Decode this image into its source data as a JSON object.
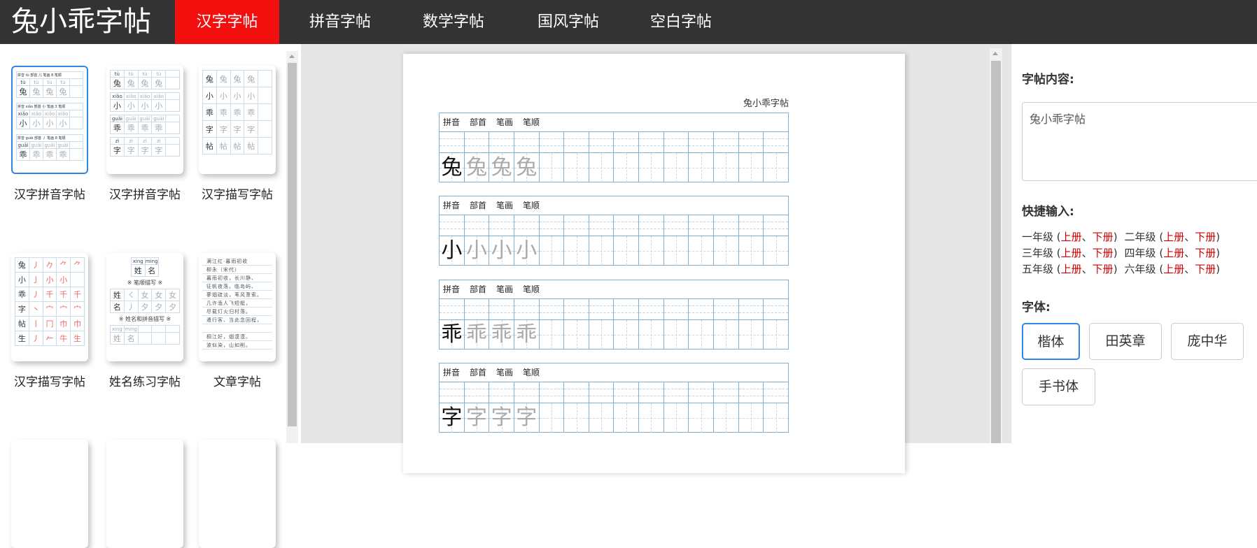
{
  "header": {
    "logo": "兔小乖字帖",
    "tabs": [
      {
        "label": "汉字字帖",
        "active": true
      },
      {
        "label": "拼音字帖"
      },
      {
        "label": "数学字帖"
      },
      {
        "label": "国风字帖"
      },
      {
        "label": "空白字帖"
      }
    ],
    "accent": "#f40f0f"
  },
  "templates": [
    {
      "label": "汉字拼音字帖",
      "selected": true,
      "blocks": [
        {
          "info": "拼音 tù   部首 儿   笔画 8   笔顺",
          "pinyin": "tù",
          "char": "兔"
        },
        {
          "info": "拼音 xiǎo   部首 小   笔画 3   笔顺",
          "pinyin": "xiǎo",
          "char": "小"
        },
        {
          "info": "拼音 guāi   部首 丿   笔画 8   笔顺",
          "pinyin": "guāi",
          "char": "乖"
        }
      ]
    },
    {
      "label": "汉字拼音字帖",
      "blocks": [
        {
          "pinyin": "tù",
          "char": "兔"
        },
        {
          "pinyin": "xiǎo",
          "char": "小"
        },
        {
          "pinyin": "guāi",
          "char": "乖"
        },
        {
          "pinyin": "zì",
          "char": "字"
        }
      ]
    },
    {
      "label": "汉字描写字帖",
      "chars": [
        "兔",
        "小",
        "乖",
        "字",
        "帖"
      ]
    },
    {
      "label": "汉字描写字帖",
      "chars": [
        "兔",
        "小",
        "乖",
        "字",
        "帖",
        "生"
      ],
      "strokes": [
        [
          "丿",
          "𠂊",
          "⺈",
          "⺈"
        ],
        [
          "亅",
          "小",
          "小",
          ""
        ],
        [
          "丿",
          "千",
          "千",
          "千"
        ],
        [
          "丶",
          "宀",
          "宀",
          "宀"
        ],
        [
          "丨",
          "冂",
          "巾",
          "巾"
        ],
        [
          "丿",
          "𠂉",
          "牛",
          "生"
        ]
      ]
    },
    {
      "label": "姓名练习字帖",
      "pinyin": [
        "xing",
        "ming"
      ],
      "name": [
        "姓",
        "名"
      ],
      "section1": "※ 笔顺描写 ※",
      "section2": "※ 姓名和拼音描写 ※",
      "strokes": [
        [
          "㇛",
          "女",
          "女",
          "女"
        ],
        [
          "丿",
          "夕",
          "夕",
          "夕"
        ]
      ]
    },
    {
      "label": "文章字帖",
      "lines": [
        "满江红·暮雨初收",
        "柳永（宋代）",
        "暮雨初收，长川静、",
        "征帆夜落。临岛屿、",
        "蓼烟疏淡，苇风萧索。",
        "几许渔人飞短艇，",
        "尽载灯火归村落。",
        "遣行客、当此念回程，",
        "",
        "桐江好，烟漠漠。",
        "波似染，山如削。"
      ]
    }
  ],
  "sheet": {
    "title": "兔小乖字帖",
    "block_header": [
      "拼音",
      "部首",
      "笔画",
      "笔顺"
    ],
    "chars": [
      "兔",
      "小",
      "乖",
      "字"
    ],
    "trace_count": 3,
    "columns": 14
  },
  "right": {
    "content_label": "字帖内容:",
    "content_value": "兔小乖字帖",
    "quick_label": "快捷输入:",
    "grades": [
      "一年级",
      "二年级",
      "三年级",
      "四年级",
      "五年级",
      "六年级"
    ],
    "upper": "上册",
    "lower": "下册",
    "font_label": "字体:",
    "fonts": [
      {
        "label": "楷体",
        "active": true
      },
      {
        "label": "田英章"
      },
      {
        "label": "庞中华"
      },
      {
        "label": "手书体"
      }
    ],
    "link_color": "#cc0000"
  }
}
